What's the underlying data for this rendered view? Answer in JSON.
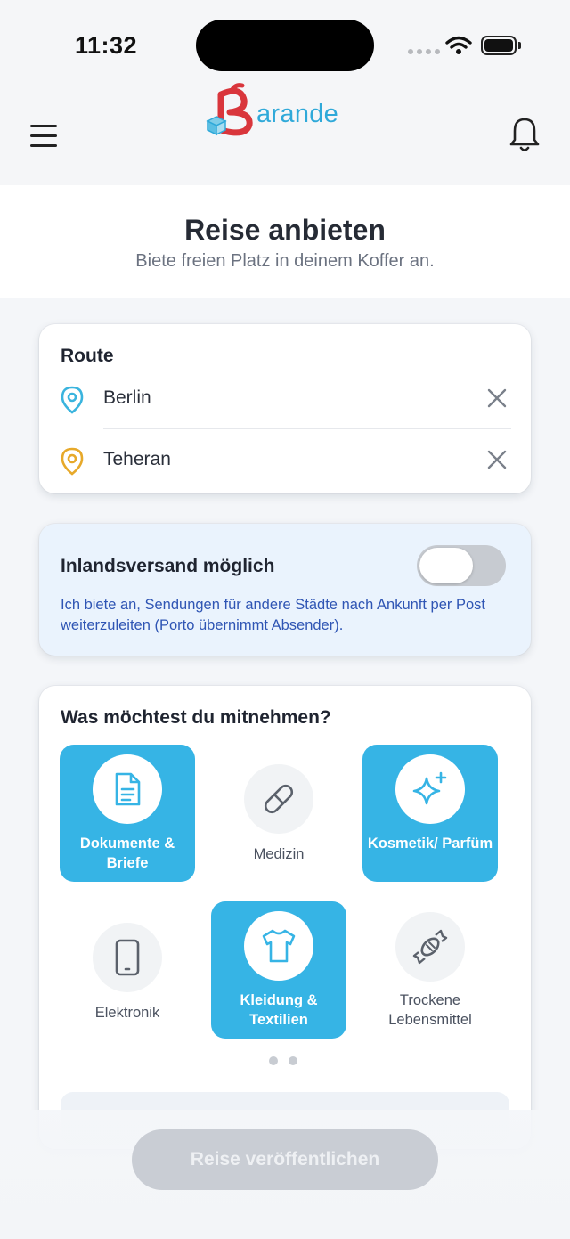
{
  "status_bar": {
    "time": "11:32"
  },
  "header": {
    "logo_text": "arande",
    "logo_letter": "B"
  },
  "page": {
    "title": "Reise anbieten",
    "subtitle": "Biete freien Platz in deinem Koffer an."
  },
  "route": {
    "heading": "Route",
    "from": "Berlin",
    "to": "Teheran",
    "pin_colors": {
      "from": "#3ab4de",
      "to": "#e7a92a"
    }
  },
  "domestic": {
    "title": "Inlandsversand möglich",
    "enabled": false,
    "description": "Ich biete an, Sendungen für andere Städte nach Ankunft per Post weiterzuleiten (Porto übernimmt Absender)."
  },
  "items": {
    "heading": "Was möchtest du mitnehmen?",
    "categories": [
      {
        "label": "Dokumente & Briefe",
        "icon": "document-icon",
        "selected": true
      },
      {
        "label": "Medizin",
        "icon": "pill-icon",
        "selected": false
      },
      {
        "label": "Kosmetik/ Parfüm",
        "icon": "sparkle-icon",
        "selected": true
      },
      {
        "label": "Elektronik",
        "icon": "phone-icon",
        "selected": false
      },
      {
        "label": "Kleidung & Textilien",
        "icon": "shirt-icon",
        "selected": true
      },
      {
        "label": "Trockene Lebensmittel",
        "icon": "candy-icon",
        "selected": false
      }
    ],
    "page_count": 2
  },
  "actions": {
    "publish_label": "Reise veröffentlichen"
  },
  "colors": {
    "accent": "#36b4e5",
    "brand_red": "#d9363c",
    "brand_blue": "#2fa9d9"
  }
}
